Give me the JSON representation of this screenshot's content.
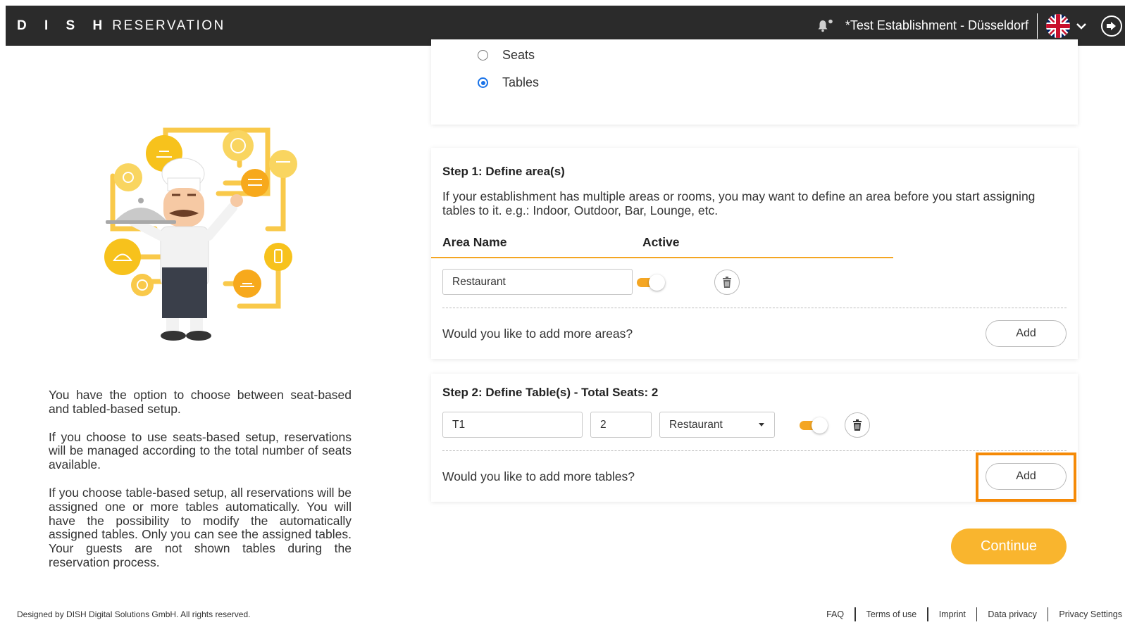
{
  "header": {
    "logo_bold": "D I S H",
    "logo_rest": "RESERVATION",
    "establishment": "*Test Establishment - Düsseldorf"
  },
  "left_panel": {
    "paragraphs": [
      "You have the option to choose between seat-based and tabled-based setup.",
      "If you choose to use seats-based setup, reservations will be managed according to the total number of seats available.",
      "If you choose table-based setup, all reservations will be assigned one or more tables automatically. You will have the possibility to modify the automatically assigned tables. Only you can see the assigned tables. Your guests are not shown tables during the reservation process."
    ]
  },
  "setup_type": {
    "options": [
      {
        "label": "Seats",
        "checked": false
      },
      {
        "label": "Tables",
        "checked": true
      }
    ]
  },
  "step1": {
    "title": "Step 1: Define area(s)",
    "description": "If your establishment has multiple areas or rooms, you may want to define an area before you start assigning tables to it. e.g.: Indoor, Outdoor, Bar, Lounge, etc.",
    "col_area_name": "Area Name",
    "col_active": "Active",
    "areas": [
      {
        "name": "Restaurant",
        "active": true
      }
    ],
    "question": "Would you like to add more areas?",
    "add_label": "Add"
  },
  "step2": {
    "title": "Step 2: Define Table(s) - Total Seats: 2",
    "tables": [
      {
        "name": "T1",
        "seats": "2",
        "area": "Restaurant",
        "active": true
      }
    ],
    "question": "Would you like to add more tables?",
    "add_label": "Add"
  },
  "continue_label": "Continue",
  "footer": {
    "copyright": "Designed by DISH Digital Solutions GmbH. All rights reserved.",
    "links": [
      "FAQ",
      "Terms of use",
      "Imprint",
      "Data privacy",
      "Privacy Settings"
    ]
  },
  "colors": {
    "header_bg": "#2b2b2b",
    "accent_orange": "#f4a623",
    "continue_bg": "#f9b52e",
    "highlight_border": "#f58a07",
    "radio_blue": "#1a73e8"
  }
}
